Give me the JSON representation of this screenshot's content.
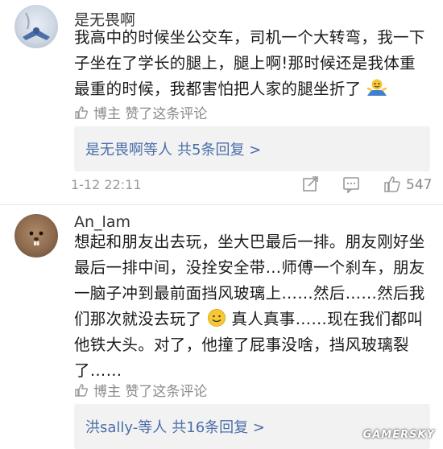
{
  "comment1": {
    "username": "是无畏啊",
    "text_lines": [
      "我高中的时候坐公交车，司机一个大转弯，我一下",
      "子坐在了学长的腿上，腿上啊!那时候还是我体重",
      "最重的时候，我都害怕把人家的腿坐折了"
    ],
    "liked_by": "博主 赞了这条评论",
    "reply_user": "是无畏啊等人",
    "reply_count": "共5条回复 >",
    "timestamp": "1-12 22:11",
    "like_count": "547"
  },
  "comment2": {
    "username": "An_lam",
    "text_lines": [
      "想起和朋友出去玩，坐大巴最后一排。朋友刚好坐",
      "最后一排中间，没拴安全带…师傅一个刹车，朋友",
      "一脑子冲到最前面挡风玻璃上……然后……然后我",
      "们那次就没去玩了",
      "真人真事……现在我们都叫",
      "他铁大头。对了，他撞了屁事没啥，挡风玻璃裂",
      "了……"
    ],
    "liked_by": "博主 赞了这条评论",
    "reply_user": "洪sally-等人",
    "reply_count": "共16条回复 >"
  },
  "watermark": "GAMERSKY",
  "colors": {
    "link": "#4a6ea9",
    "muted": "#8a8a8a",
    "reply_bg": "#f2f2f2"
  }
}
